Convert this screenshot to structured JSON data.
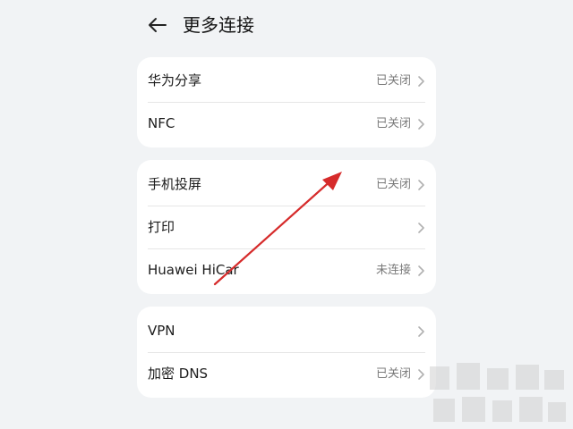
{
  "header": {
    "title": "更多连接"
  },
  "sections": [
    {
      "items": [
        {
          "label": "华为分享",
          "value": "已关闭"
        },
        {
          "label": "NFC",
          "value": "已关闭"
        }
      ]
    },
    {
      "items": [
        {
          "label": "手机投屏",
          "value": "已关闭"
        },
        {
          "label": "打印",
          "value": ""
        },
        {
          "label": "Huawei HiCar",
          "value": "未连接"
        }
      ]
    },
    {
      "items": [
        {
          "label": "VPN",
          "value": ""
        },
        {
          "label": "加密 DNS",
          "value": "已关闭"
        }
      ]
    }
  ],
  "colors": {
    "annotation_arrow": "#d62b2b",
    "value_text": "#7a7a7a"
  }
}
